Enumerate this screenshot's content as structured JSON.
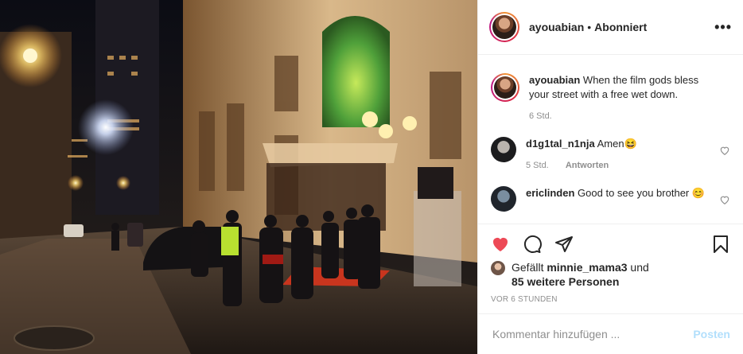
{
  "header": {
    "username": "ayouabian",
    "separator": "•",
    "follow_state": "Abonniert",
    "more_label": "•••"
  },
  "caption": {
    "username": "ayouabian",
    "text": "When the film gods bless your street with a free wet down.",
    "time": "6 Std."
  },
  "comments": [
    {
      "username": "d1g1tal_n1nja",
      "text": "Amen😆",
      "time": "5 Std.",
      "reply_label": "Antworten"
    },
    {
      "username": "ericlinden",
      "text": "Good to see you brother 😊"
    }
  ],
  "likes": {
    "prefix": "Gefällt",
    "user": "minnie_mama3",
    "connector": "und",
    "others": "85 weitere Personen"
  },
  "timestamp": "VOR 6 STUNDEN",
  "comment_box": {
    "placeholder": "Kommentar hinzufügen ...",
    "post_label": "Posten"
  },
  "colors": {
    "like_red": "#ed4956",
    "post_disabled": "#b2dffc",
    "muted": "#8e8e8e"
  }
}
